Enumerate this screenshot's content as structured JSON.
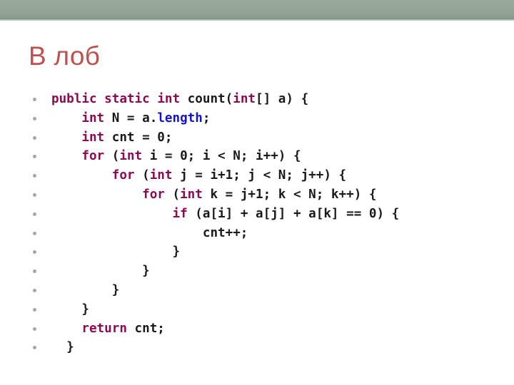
{
  "slide": {
    "title": "В лоб",
    "title_color": "#c0504d",
    "band_color": "#93a596",
    "background_color": "#ffffff"
  },
  "theme": {
    "keyword_color": "#8c0a52",
    "property_color": "#1313cd",
    "default_color": "#1a1a1a",
    "bullet_color": "#a6a6a6"
  },
  "code": {
    "language": "java",
    "plain_text": "public static int count(int[] a) {\n    int N = a.length;\n    int cnt = 0;\n    for (int i = 0; i < N; i++) {\n        for (int j = i+1; j < N; j++) {\n            for (int k = j+1; k < N; k++) {\n                if (a[i] + a[j] + a[k] == 0) {\n                    cnt++;\n                }\n            }\n        }\n    }\n    return cnt;\n  }",
    "lines": [
      {
        "tokens": [
          {
            "t": "public",
            "k": "kw"
          },
          {
            "t": " ",
            "k": "def"
          },
          {
            "t": "static",
            "k": "kw"
          },
          {
            "t": " ",
            "k": "def"
          },
          {
            "t": "int",
            "k": "kw"
          },
          {
            "t": " count(",
            "k": "def"
          },
          {
            "t": "int",
            "k": "kw"
          },
          {
            "t": "[] a) {",
            "k": "def"
          }
        ]
      },
      {
        "tokens": [
          {
            "t": "    ",
            "k": "def"
          },
          {
            "t": "int",
            "k": "kw"
          },
          {
            "t": " N = a.",
            "k": "def"
          },
          {
            "t": "length",
            "k": "prop"
          },
          {
            "t": ";",
            "k": "def"
          }
        ]
      },
      {
        "tokens": [
          {
            "t": "    ",
            "k": "def"
          },
          {
            "t": "int",
            "k": "kw"
          },
          {
            "t": " cnt = 0;",
            "k": "def"
          }
        ]
      },
      {
        "tokens": [
          {
            "t": "    ",
            "k": "def"
          },
          {
            "t": "for",
            "k": "kw"
          },
          {
            "t": " (",
            "k": "def"
          },
          {
            "t": "int",
            "k": "kw"
          },
          {
            "t": " i = 0; i < N; i++) {",
            "k": "def"
          }
        ]
      },
      {
        "tokens": [
          {
            "t": "        ",
            "k": "def"
          },
          {
            "t": "for",
            "k": "kw"
          },
          {
            "t": " (",
            "k": "def"
          },
          {
            "t": "int",
            "k": "kw"
          },
          {
            "t": " j = i+1; j < N; j++) {",
            "k": "def"
          }
        ]
      },
      {
        "tokens": [
          {
            "t": "            ",
            "k": "def"
          },
          {
            "t": "for",
            "k": "kw"
          },
          {
            "t": " (",
            "k": "def"
          },
          {
            "t": "int",
            "k": "kw"
          },
          {
            "t": " k = j+1; k < N; k++) {",
            "k": "def"
          }
        ]
      },
      {
        "tokens": [
          {
            "t": "                ",
            "k": "def"
          },
          {
            "t": "if",
            "k": "kw"
          },
          {
            "t": " (a[i] + a[j] + a[k] == 0) {",
            "k": "def"
          }
        ]
      },
      {
        "tokens": [
          {
            "t": "                    cnt++;",
            "k": "def"
          }
        ]
      },
      {
        "tokens": [
          {
            "t": "                }",
            "k": "def"
          }
        ]
      },
      {
        "tokens": [
          {
            "t": "            }",
            "k": "def"
          }
        ]
      },
      {
        "tokens": [
          {
            "t": "        }",
            "k": "def"
          }
        ]
      },
      {
        "tokens": [
          {
            "t": "    }",
            "k": "def"
          }
        ]
      },
      {
        "tokens": [
          {
            "t": "    ",
            "k": "def"
          },
          {
            "t": "return",
            "k": "kw"
          },
          {
            "t": " cnt;",
            "k": "def"
          }
        ]
      },
      {
        "tokens": [
          {
            "t": "  }",
            "k": "def"
          }
        ]
      }
    ]
  }
}
